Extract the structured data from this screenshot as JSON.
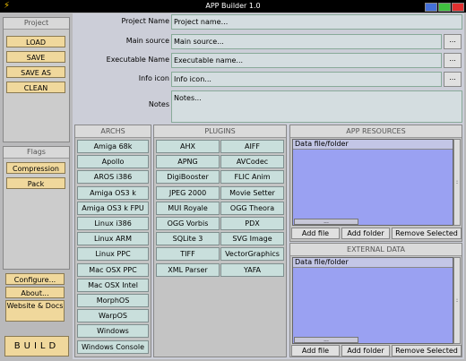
{
  "window": {
    "title": "APP Builder 1.0"
  },
  "sidebar": {
    "project_title": "Project",
    "project_buttons": [
      "LOAD",
      "SAVE",
      "SAVE AS",
      "CLEAN"
    ],
    "flags_title": "Flags",
    "flag_buttons": [
      "Compression",
      "Pack"
    ],
    "bottom_buttons": [
      "Configure...",
      "About...",
      "Website & Docs"
    ],
    "build_label": "BUILD"
  },
  "form": {
    "project_name_label": "Project Name",
    "project_name_placeholder": "Project name...",
    "main_source_label": "Main source",
    "main_source_placeholder": "Main source...",
    "executable_label": "Executable Name",
    "executable_placeholder": "Executable name...",
    "icon_label": "Info icon",
    "icon_placeholder": "Info icon...",
    "notes_label": "Notes",
    "notes_placeholder": "Notes...",
    "browse": "..."
  },
  "archs": {
    "title": "ARCHS",
    "items": [
      "Amiga 68k",
      "Apollo",
      "AROS i386",
      "Amiga OS3 k",
      "Amiga OS3 k FPU",
      "Linux i386",
      "Linux ARM",
      "Linux PPC",
      "Mac OSX PPC",
      "Mac OSX Intel",
      "MorphOS",
      "WarpOS",
      "Windows",
      "Windows Console"
    ]
  },
  "plugins": {
    "title": "PLUGINS",
    "items": [
      "AHX",
      "AIFF",
      "APNG",
      "AVCodec",
      "DigiBooster",
      "FLIC Anim",
      "JPEG 2000",
      "Movie Setter",
      "MUI Royale",
      "OGG Theora",
      "OGG Vorbis",
      "PDX",
      "SQLite 3",
      "SVG Image",
      "TIFF",
      "VectorGraphics",
      "XML Parser",
      "YAFA"
    ]
  },
  "resources": {
    "title": "APP RESOURCES",
    "list_header": "Data file/folder",
    "add_file": "Add file",
    "add_folder": "Add folder",
    "remove": "Remove Selected"
  },
  "external": {
    "title": "EXTERNAL DATA",
    "list_header": "Data file/folder",
    "add_file": "Add file",
    "add_folder": "Add folder",
    "remove": "Remove Selected"
  },
  "colors": {
    "button": "#f0d89c",
    "list": "#9aa1f2",
    "cell": "#c9dfdc"
  }
}
